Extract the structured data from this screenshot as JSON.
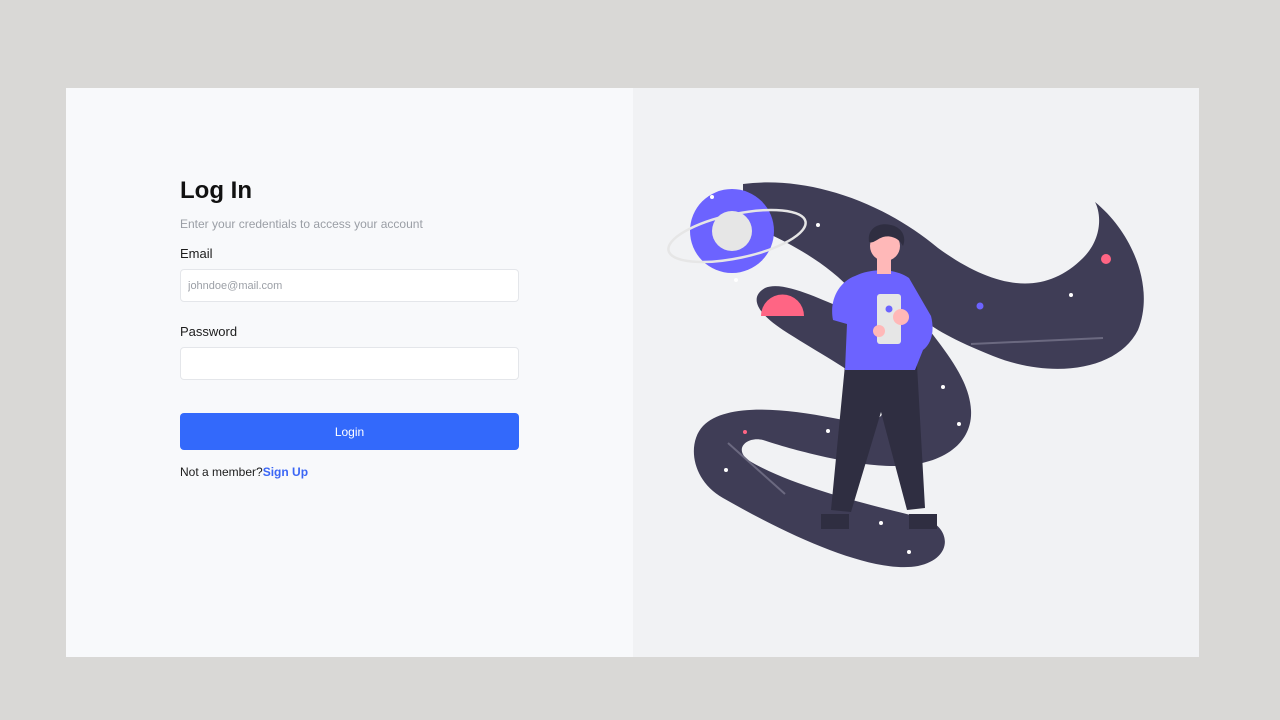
{
  "login": {
    "title": "Log In",
    "subtitle": "Enter your credentials to access your account",
    "email_label": "Email",
    "email_placeholder": "johndoe@mail.com",
    "email_value": "",
    "password_label": "Password",
    "password_value": "",
    "login_button_label": "Login",
    "signup_prompt": "Not a member?",
    "signup_link": "Sign Up"
  },
  "colors": {
    "accent": "#3369fb",
    "link": "#3b66f5",
    "illustration_dark": "#3f3d56",
    "illustration_purple": "#6c63ff",
    "illustration_pink": "#ff6584",
    "page_background": "#d9d8d6",
    "left_background": "#f8f9fb",
    "right_background": "#f1f2f4"
  },
  "illustration": {
    "icon": "person-holding-phone-in-space-illustration"
  }
}
